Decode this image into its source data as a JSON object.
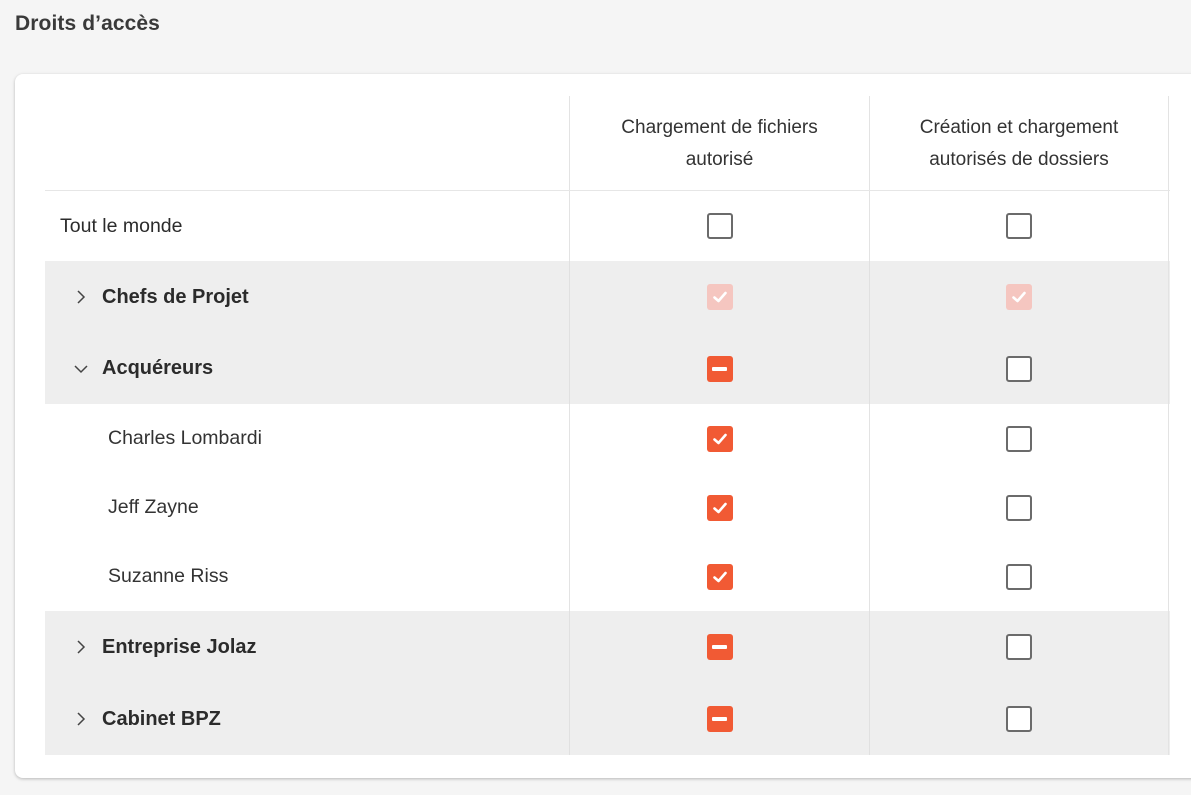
{
  "page": {
    "title": "Droits d’accès"
  },
  "colors": {
    "accent": "#f15a34",
    "accent_disabled": "#f5c6c0",
    "row_group_bg": "#eeeeee"
  },
  "table": {
    "columns": [
      "Chargement de fichiers autorisé",
      "Création et chargement autorisés de dossiers"
    ],
    "rows": [
      {
        "label": "Tout le monde",
        "kind": "everyone",
        "expander": "none",
        "upload": "unchecked",
        "folders": "unchecked"
      },
      {
        "label": "Chefs de Projet",
        "kind": "group",
        "expander": "chevron-right-icon",
        "upload": "checked-disabled",
        "folders": "checked-disabled"
      },
      {
        "label": "Acquéreurs",
        "kind": "group",
        "expander": "chevron-down-icon",
        "upload": "indeterminate",
        "folders": "unchecked"
      },
      {
        "label": "Charles Lombardi",
        "kind": "member",
        "expander": "none",
        "upload": "checked",
        "folders": "unchecked"
      },
      {
        "label": "Jeff Zayne",
        "kind": "member",
        "expander": "none",
        "upload": "checked",
        "folders": "unchecked"
      },
      {
        "label": "Suzanne Riss",
        "kind": "member",
        "expander": "none",
        "upload": "checked",
        "folders": "unchecked"
      },
      {
        "label": "Entreprise Jolaz",
        "kind": "group",
        "expander": "chevron-right-icon",
        "upload": "indeterminate",
        "folders": "unchecked"
      },
      {
        "label": "Cabinet BPZ",
        "kind": "group",
        "expander": "chevron-right-icon",
        "upload": "indeterminate",
        "folders": "unchecked"
      }
    ]
  }
}
